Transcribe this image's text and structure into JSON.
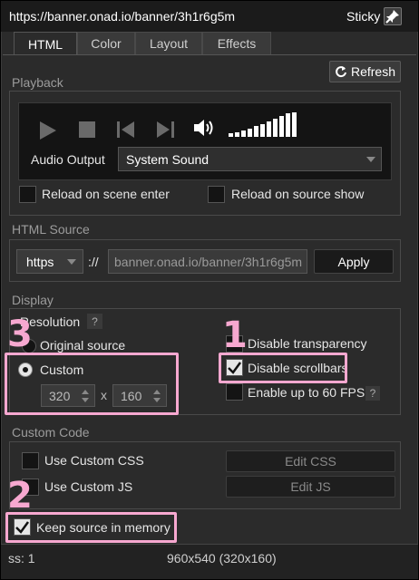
{
  "window": {
    "url": "https://banner.onad.io/banner/3h1r6g5m",
    "sticky_label": "Sticky"
  },
  "tabs": [
    {
      "label": "HTML",
      "active": true
    },
    {
      "label": "Color",
      "active": false
    },
    {
      "label": "Layout",
      "active": false
    },
    {
      "label": "Effects",
      "active": false
    }
  ],
  "toolbar": {
    "refresh_label": "Refresh"
  },
  "playback": {
    "title": "Playback",
    "audio_output_label": "Audio Output",
    "audio_output_value": "System Sound",
    "reload_scene_label": "Reload on scene enter",
    "reload_source_label": "Reload on source show",
    "volume_level": 1.0
  },
  "html_source": {
    "title": "HTML Source",
    "protocol": "https",
    "separator": "://",
    "url_value": "banner.onad.io/banner/3h1r6g5m",
    "apply_label": "Apply"
  },
  "display": {
    "title": "Display",
    "resolution_label": "Resolution",
    "help_mark": "?",
    "original_source_label": "Original source",
    "custom_label": "Custom",
    "width_value": "320",
    "times": "x",
    "height_value": "160",
    "disable_transparency_label": "Disable transparency",
    "disable_scrollbars_label": "Disable scrollbars",
    "disable_scrollbars_checked": true,
    "fps_label": "Enable up to 60 FPS"
  },
  "custom_code": {
    "title": "Custom Code",
    "css_label": "Use Custom CSS",
    "js_label": "Use Custom JS",
    "edit_css_label": "Edit CSS",
    "edit_js_label": "Edit JS"
  },
  "memory": {
    "keep_label": "Keep source in memory",
    "checked": true
  },
  "status": {
    "left": "ss: 1",
    "center": "960x540 (320x160)"
  },
  "annotations": [
    "1",
    "2",
    "3"
  ],
  "colors": {
    "highlight": "#f7a8d0",
    "panel": "#2b2b2b",
    "field": "#141414"
  }
}
